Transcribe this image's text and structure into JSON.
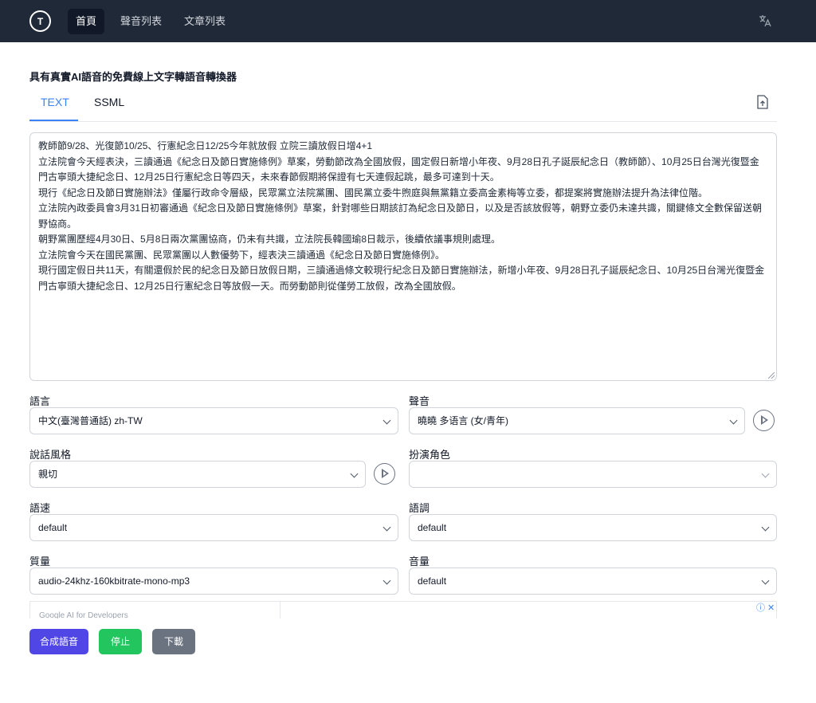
{
  "nav": {
    "logo_text": "T",
    "items": [
      {
        "label": "首頁",
        "active": true
      },
      {
        "label": "聲音列表"
      },
      {
        "label": "文章列表"
      }
    ],
    "translate_icon": "translate-icon"
  },
  "page": {
    "title": "具有真實AI語音的免費線上文字轉語音轉換器",
    "tabs": [
      {
        "label": "TEXT",
        "active": true
      },
      {
        "label": "SSML"
      }
    ],
    "upload_icon": "upload-file-icon"
  },
  "text_content": [
    "教師節9/28、光復節10/25、行憲紀念日12/25今年就放假 立院三讀放假日增4+1",
    "立法院會今天經表決，三讀通過《紀念日及節日實施條例》草案，勞動節改為全國放假，國定假日新增小年夜、9月28日孔子誕辰紀念日（教師節）、10月25日台灣光復暨金門古寧頭大捷紀念日、12月25日行憲紀念日等四天，未來春節假期將保證有七天連假起跳，最多可達到十天。",
    "現行《紀念日及節日實施辦法》僅屬行政命令層級，民眾黨立法院黨團、國民黨立委牛煦庭與無黨籍立委高金素梅等立委，都提案將實施辦法提升為法律位階。",
    "立法院內政委員會3月31日初審通過《紀念日及節日實施條例》草案，針對哪些日期該訂為紀念日及節日，以及是否該放假等，朝野立委仍未達共識，關鍵條文全數保留送朝野協商。",
    "朝野黨團歷經4月30日、5月8日兩次黨團協商，仍未有共識，立法院長韓國瑜8日裁示，後續依議事規則處理。",
    "立法院會今天在國民黨團、民眾黨團以人數優勢下，經表決三讀通過《紀念日及節日實施條例》。",
    "現行國定假日共11天，有關還假於民的紀念日及節日放假日期，三讀通過條文較現行紀念日及節日實施辦法，新增小年夜、9月28日孔子誕辰紀念日、10月25日台灣光復暨金門古寧頭大捷紀念日、12月25日行憲紀念日等放假一天。而勞動節則從僅勞工放假，改為全國放假。"
  ],
  "fields": {
    "language": {
      "label": "語言",
      "value": "中文(臺灣普通話) zh-TW"
    },
    "voice": {
      "label": "聲音",
      "value": "曉曉 多语言 (女/青年)"
    },
    "style": {
      "label": "說話風格",
      "value": "親切"
    },
    "role": {
      "label": "扮演角色",
      "value": ""
    },
    "rate": {
      "label": "語速",
      "value": "default"
    },
    "pitch": {
      "label": "語調",
      "value": "default"
    },
    "quality": {
      "label": "質量",
      "value": "audio-24khz-160kbitrate-mono-mp3"
    },
    "volume": {
      "label": "音量",
      "value": "default"
    }
  },
  "ad": {
    "text": "Google AI for Developers",
    "controls": "ⓘ ✕"
  },
  "buttons": {
    "synthesize": "合成語音",
    "stop": "停止",
    "download": "下載"
  },
  "colors": {
    "navbar": "#1f2937",
    "accent": "#3b82f6",
    "synthesize": "#4f46e5",
    "stop": "#22c55e",
    "download": "#6b7280"
  }
}
